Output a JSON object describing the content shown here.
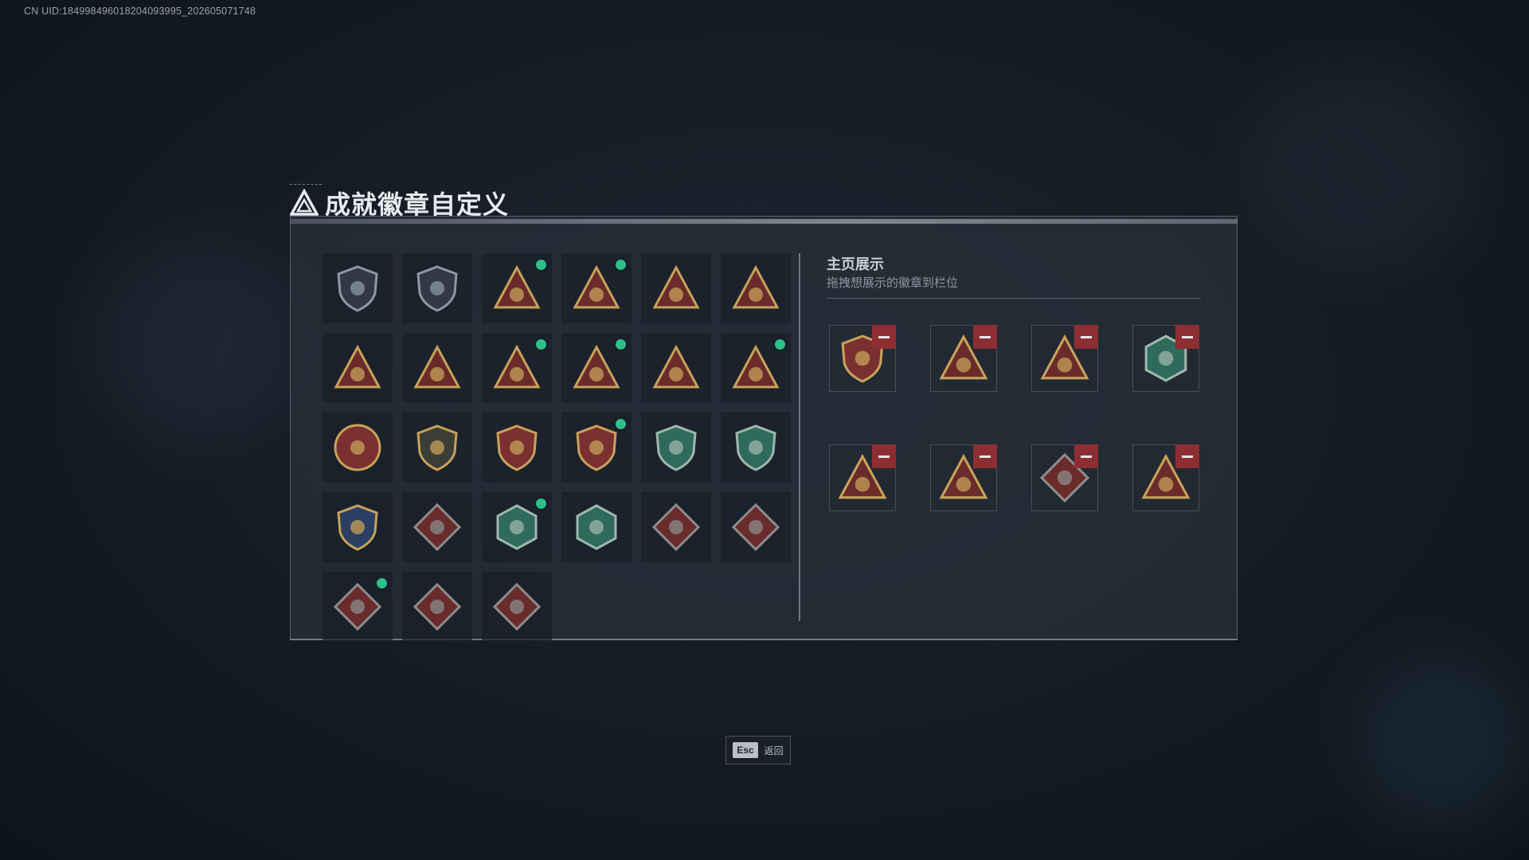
{
  "uid": "CN UID:1849984960182040939​95_202605071748",
  "title": "成就徽章自定义",
  "right_panel": {
    "title": "主页展示",
    "subtitle": "拖拽想展示的徽章到栏位"
  },
  "colors": {
    "gold": "#c7a25a",
    "dark_red": "#6a2b2b",
    "teal": "#2f6a5a",
    "new_dot": "#2fbf8a",
    "remove": "#8d2e33"
  },
  "badges": [
    {
      "icon": "shield-triangle-badge-icon",
      "shape": "shield",
      "fill": "#2f3a45",
      "stroke": "#8c99a6",
      "new": false
    },
    {
      "icon": "helicopter-badge-icon",
      "shape": "shield",
      "fill": "#2f3a45",
      "stroke": "#8c99a6",
      "new": false
    },
    {
      "icon": "money-bag-badge-icon",
      "shape": "triangle",
      "fill": "#6a2b2b",
      "stroke": "#c7a25a",
      "new": true
    },
    {
      "icon": "money-bag-5b-badge-icon",
      "shape": "triangle",
      "fill": "#6a2b2b",
      "stroke": "#c7a25a",
      "new": true
    },
    {
      "icon": "safe-box-badge-icon",
      "shape": "triangle",
      "fill": "#6a2b2b",
      "stroke": "#c7a25a",
      "new": false
    },
    {
      "icon": "safe-5b-badge-icon",
      "shape": "triangle",
      "fill": "#6a2b2b",
      "stroke": "#c7a25a",
      "new": false
    },
    {
      "icon": "gold-pile-badge-icon",
      "shape": "triangle",
      "fill": "#6a2b2b",
      "stroke": "#c7a25a",
      "new": false
    },
    {
      "icon": "number-one-badge-icon",
      "shape": "triangle",
      "fill": "#6a2b2b",
      "stroke": "#c7a25a",
      "new": false
    },
    {
      "icon": "gold-bar-badge-icon",
      "shape": "triangle",
      "fill": "#6a2b2b",
      "stroke": "#c7a25a",
      "new": true
    },
    {
      "icon": "laurel-crest-badge-icon",
      "shape": "triangle",
      "fill": "#6a2b2b",
      "stroke": "#c7a25a",
      "new": true
    },
    {
      "icon": "soldiers-badge-icon",
      "shape": "triangle",
      "fill": "#6a2b2b",
      "stroke": "#c7a25a",
      "new": false
    },
    {
      "icon": "rockets-badge-icon",
      "shape": "triangle",
      "fill": "#6a2b2b",
      "stroke": "#c7a25a",
      "new": true
    },
    {
      "icon": "compass-star-badge-icon",
      "shape": "round",
      "fill": "#7a3030",
      "stroke": "#c7a25a",
      "new": false
    },
    {
      "icon": "chevron-shield-badge-icon",
      "shape": "shield",
      "fill": "#3a3e36",
      "stroke": "#c7a25a",
      "new": false
    },
    {
      "icon": "eagle-crest-badge-icon",
      "shape": "shield",
      "fill": "#7a3030",
      "stroke": "#c7a25a",
      "new": false
    },
    {
      "icon": "eagle-crest-2-badge-icon",
      "shape": "shield",
      "fill": "#7a3030",
      "stroke": "#c7a25a",
      "new": true
    },
    {
      "icon": "crosshair-rifle-badge-icon",
      "shape": "shield",
      "fill": "#2f6a5a",
      "stroke": "#9fb7ad",
      "new": false
    },
    {
      "icon": "crosshair-rifle-2-badge-icon",
      "shape": "shield",
      "fill": "#2f6a5a",
      "stroke": "#9fb7ad",
      "new": false
    },
    {
      "icon": "wings-crest-badge-icon",
      "shape": "shield",
      "fill": "#2b3f64",
      "stroke": "#c7a25a",
      "new": false
    },
    {
      "icon": "wolf-badge-icon",
      "shape": "diamond",
      "fill": "#6a2b2b",
      "stroke": "#8c8c8c",
      "new": false
    },
    {
      "icon": "hornet-badge-icon",
      "shape": "hex",
      "fill": "#2f6a5a",
      "stroke": "#9fb7ad",
      "new": true
    },
    {
      "icon": "bullets-badge-icon",
      "shape": "hex",
      "fill": "#2f6a5a",
      "stroke": "#9fb7ad",
      "new": false
    },
    {
      "icon": "dragon-badge-icon",
      "shape": "diamond",
      "fill": "#6a2b2b",
      "stroke": "#8c8c8c",
      "new": false
    },
    {
      "icon": "dragon-2-badge-icon",
      "shape": "diamond",
      "fill": "#6a2b2b",
      "stroke": "#8c8c8c",
      "new": false
    },
    {
      "icon": "runner-badge-icon",
      "shape": "diamond",
      "fill": "#6a2b2b",
      "stroke": "#8c8c8c",
      "new": true
    },
    {
      "icon": "horse-badge-icon",
      "shape": "diamond",
      "fill": "#6a2b2b",
      "stroke": "#8c8c8c",
      "new": false
    },
    {
      "icon": "medkit-badge-icon",
      "shape": "diamond",
      "fill": "#6a2b2b",
      "stroke": "#8c8c8c",
      "new": false
    }
  ],
  "showcase": [
    {
      "icon": "eagle-crest-2-badge-icon",
      "shape": "shield",
      "fill": "#7a3030",
      "stroke": "#c7a25a"
    },
    {
      "icon": "money-bag-badge-icon",
      "shape": "triangle",
      "fill": "#6a2b2b",
      "stroke": "#c7a25a"
    },
    {
      "icon": "gold-bar-badge-icon",
      "shape": "triangle",
      "fill": "#6a2b2b",
      "stroke": "#c7a25a"
    },
    {
      "icon": "hornet-badge-icon",
      "shape": "hex",
      "fill": "#2f6a5a",
      "stroke": "#9fb7ad"
    },
    {
      "icon": "rockets-badge-icon",
      "shape": "triangle",
      "fill": "#6a2b2b",
      "stroke": "#c7a25a"
    },
    {
      "icon": "money-bag-5b-badge-icon",
      "shape": "triangle",
      "fill": "#6a2b2b",
      "stroke": "#c7a25a"
    },
    {
      "icon": "runner-badge-icon",
      "shape": "diamond",
      "fill": "#6a2b2b",
      "stroke": "#8c8c8c"
    },
    {
      "icon": "laurel-crest-badge-icon",
      "shape": "triangle",
      "fill": "#6a2b2b",
      "stroke": "#c7a25a"
    }
  ],
  "footer": {
    "esc_key": "Esc",
    "back_label": "返回"
  }
}
